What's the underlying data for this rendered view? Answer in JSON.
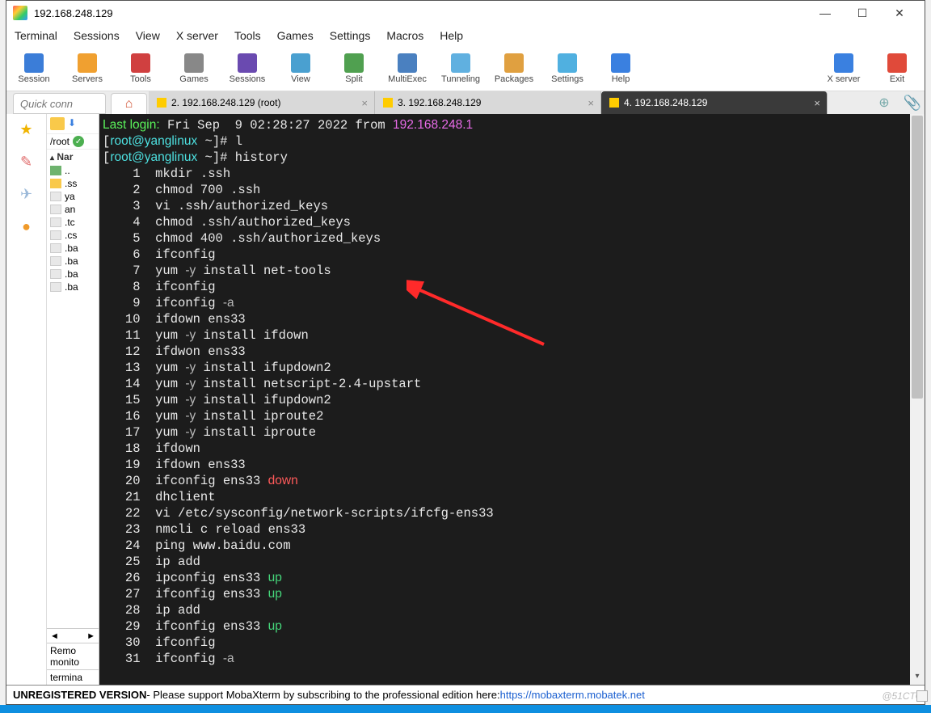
{
  "window": {
    "title": "192.168.248.129"
  },
  "menubar": [
    "Terminal",
    "Sessions",
    "View",
    "X server",
    "Tools",
    "Games",
    "Settings",
    "Macros",
    "Help"
  ],
  "toolbar": {
    "left": [
      {
        "label": "Session",
        "color": "#3b7dd8"
      },
      {
        "label": "Servers",
        "color": "#f0a030"
      },
      {
        "label": "Tools",
        "color": "#d04040"
      },
      {
        "label": "Games",
        "color": "#888"
      },
      {
        "label": "Sessions",
        "color": "#6a4ab0"
      },
      {
        "label": "View",
        "color": "#4aa0d0"
      },
      {
        "label": "Split",
        "color": "#50a050"
      },
      {
        "label": "MultiExec",
        "color": "#4a80c0"
      },
      {
        "label": "Tunneling",
        "color": "#60b0e0"
      },
      {
        "label": "Packages",
        "color": "#e0a040"
      },
      {
        "label": "Settings",
        "color": "#50b0e0"
      },
      {
        "label": "Help",
        "color": "#3a80e0"
      }
    ],
    "right": [
      {
        "label": "X server",
        "color": "#3a80e0"
      },
      {
        "label": "Exit",
        "color": "#e04a3a"
      }
    ]
  },
  "quickconnect_placeholder": "Quick conn",
  "tabs": [
    {
      "label": "2. 192.168.248.129 (root)",
      "active": false
    },
    {
      "label": "3. 192.168.248.129",
      "active": false
    },
    {
      "label": "4. 192.168.248.129",
      "active": true
    }
  ],
  "sidebar_path": "/root",
  "filetree": {
    "header": "Nar",
    "items": [
      {
        "name": "..",
        "type": "folder",
        "color": "#6eb36e"
      },
      {
        "name": ".ss",
        "type": "folder",
        "color": "#f9c94a"
      },
      {
        "name": "ya",
        "type": "file"
      },
      {
        "name": "an",
        "type": "file"
      },
      {
        "name": ".tc",
        "type": "file"
      },
      {
        "name": ".cs",
        "type": "file"
      },
      {
        "name": ".ba",
        "type": "file"
      },
      {
        "name": ".ba",
        "type": "file"
      },
      {
        "name": ".ba",
        "type": "file"
      },
      {
        "name": ".ba",
        "type": "file"
      }
    ],
    "remote_label": "Remo",
    "monitor_label": "monito",
    "terminal_label": "termina"
  },
  "terminal": {
    "login_prefix": "Last login:",
    "login_date": " Fri Sep  9 02:28:27 2022 from ",
    "login_ip": "192.168.248.1",
    "prompt_user": "root@yanglinux",
    "prompt_path": "~",
    "cmd1": "l",
    "cmd2": "history",
    "history": [
      {
        "n": 1,
        "t": "mkdir .ssh"
      },
      {
        "n": 2,
        "t": "chmod 700 .ssh"
      },
      {
        "n": 3,
        "t": "vi .ssh/authorized_keys"
      },
      {
        "n": 4,
        "t": "chmod .ssh/authorized_keys"
      },
      {
        "n": 5,
        "t": "chmod 400 .ssh/authorized_keys"
      },
      {
        "n": 6,
        "t": "ifconfig"
      },
      {
        "n": 7,
        "t": "yum -y install net-tools",
        "opt": "-y"
      },
      {
        "n": 8,
        "t": "ifconfig"
      },
      {
        "n": 9,
        "t": "ifconfig -a",
        "opt": "-a"
      },
      {
        "n": 10,
        "t": "ifdown ens33"
      },
      {
        "n": 11,
        "t": "yum -y install ifdown",
        "opt": "-y"
      },
      {
        "n": 12,
        "t": "ifdwon ens33"
      },
      {
        "n": 13,
        "t": "yum -y install ifupdown2",
        "opt": "-y"
      },
      {
        "n": 14,
        "t": "yum -y install netscript-2.4-upstart",
        "opt": "-y"
      },
      {
        "n": 15,
        "t": "yum -y install ifupdown2",
        "opt": "-y"
      },
      {
        "n": 16,
        "t": "yum -y install iproute2",
        "opt": "-y"
      },
      {
        "n": 17,
        "t": "yum -y install iproute",
        "opt": "-y"
      },
      {
        "n": 18,
        "t": "ifdown"
      },
      {
        "n": 19,
        "t": "ifdown ens33"
      },
      {
        "n": 20,
        "t": "ifconfig ens33 down",
        "red": "down"
      },
      {
        "n": 21,
        "t": "dhclient"
      },
      {
        "n": 22,
        "t": "vi /etc/sysconfig/network-scripts/ifcfg-ens33"
      },
      {
        "n": 23,
        "t": "nmcli c reload ens33"
      },
      {
        "n": 24,
        "t": "ping www.baidu.com"
      },
      {
        "n": 25,
        "t": "ip add"
      },
      {
        "n": 26,
        "t": "ipconfig ens33 up",
        "up": "up"
      },
      {
        "n": 27,
        "t": "ifconfig ens33 up",
        "up": "up"
      },
      {
        "n": 28,
        "t": "ip add"
      },
      {
        "n": 29,
        "t": "ifconfig ens33 up",
        "up": "up"
      },
      {
        "n": 30,
        "t": "ifconfig"
      },
      {
        "n": 31,
        "t": "ifconfig -a",
        "opt": "-a"
      }
    ]
  },
  "status": {
    "unreg": "UNREGISTERED VERSION",
    "msg": "  -  Please support MobaXterm by subscribing to the professional edition here:  ",
    "link": "https://mobaxterm.mobatek.net"
  },
  "watermark": "@51CTO"
}
